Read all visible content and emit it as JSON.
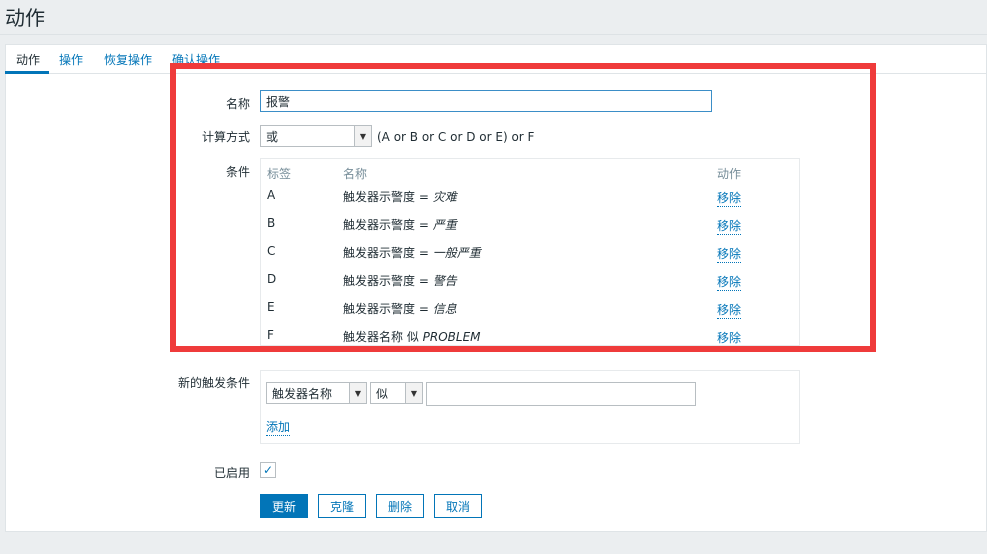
{
  "page": {
    "title": "动作"
  },
  "tabs": [
    {
      "label": "动作",
      "active": true
    },
    {
      "label": "操作",
      "active": false
    },
    {
      "label": "恢复操作",
      "active": false
    },
    {
      "label": "确认操作",
      "active": false
    }
  ],
  "form": {
    "name_label": "名称",
    "name_value": "报警",
    "calc_label": "计算方式",
    "calc_value": "或",
    "formula": "(A or B or C or D or E) or F",
    "conditions_label": "条件",
    "conditions_headers": {
      "label": "标签",
      "name": "名称",
      "action": "动作"
    },
    "conditions": [
      {
        "label": "A",
        "name": "触发器示警度 = ",
        "value": "灾难",
        "action": "移除"
      },
      {
        "label": "B",
        "name": "触发器示警度 = ",
        "value": "严重",
        "action": "移除"
      },
      {
        "label": "C",
        "name": "触发器示警度 = ",
        "value": "一般严重",
        "action": "移除"
      },
      {
        "label": "D",
        "name": "触发器示警度 = ",
        "value": "警告",
        "action": "移除"
      },
      {
        "label": "E",
        "name": "触发器示警度 = ",
        "value": "信息",
        "action": "移除"
      },
      {
        "label": "F",
        "name": "触发器名称 似 ",
        "value": "PROBLEM",
        "action": "移除"
      }
    ],
    "new_condition_label": "新的触发条件",
    "new_condition_type": "触发器名称",
    "new_condition_operator": "似",
    "new_condition_value": "",
    "add_link": "添加",
    "enabled_label": "已启用",
    "enabled_checked": true,
    "enabled_mark": "✓"
  },
  "buttons": {
    "update": "更新",
    "clone": "克隆",
    "delete": "删除",
    "cancel": "取消"
  },
  "colors": {
    "accent": "#0275b8",
    "highlight": "#ef3b3b"
  }
}
